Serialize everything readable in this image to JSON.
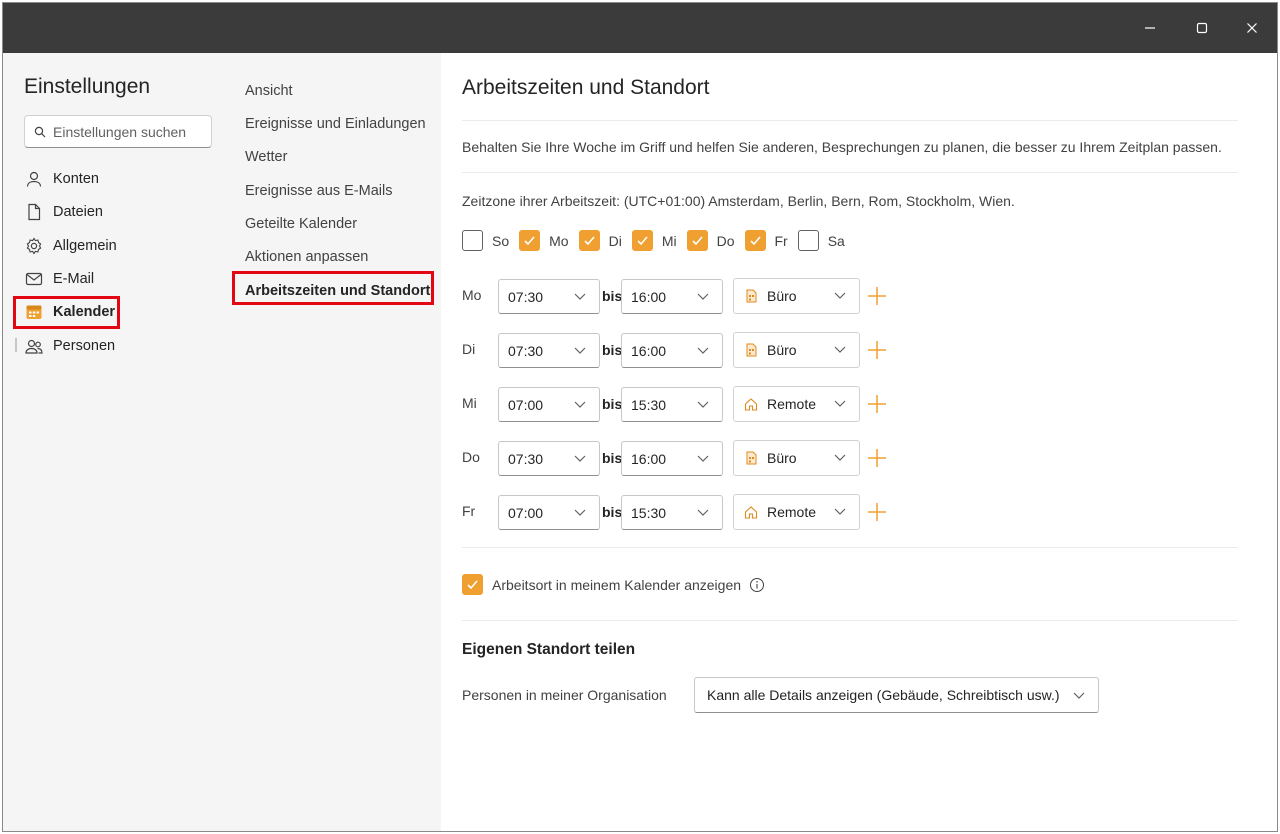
{
  "window": {
    "controls": {
      "minimize_icon": "minimize-icon",
      "maximize_icon": "maximize-icon",
      "close_icon": "close-icon"
    }
  },
  "settings_nav": {
    "heading": "Einstellungen",
    "search_placeholder": "Einstellungen suchen",
    "items": [
      {
        "label": "Konten",
        "icon": "person-icon"
      },
      {
        "label": "Dateien",
        "icon": "document-icon"
      },
      {
        "label": "Allgemein",
        "icon": "gear-icon"
      },
      {
        "label": "E-Mail",
        "icon": "mail-icon"
      },
      {
        "label": "Kalender",
        "icon": "calendar-icon",
        "active": true
      },
      {
        "label": "Personen",
        "icon": "people-icon"
      }
    ]
  },
  "calendar_nav": {
    "items": [
      {
        "label": "Ansicht"
      },
      {
        "label": "Ereignisse und Einladungen"
      },
      {
        "label": "Wetter"
      },
      {
        "label": "Ereignisse aus E-Mails"
      },
      {
        "label": "Geteilte Kalender"
      },
      {
        "label": "Aktionen anpassen"
      },
      {
        "label": "Arbeitszeiten und Standort",
        "active": true
      }
    ]
  },
  "main": {
    "title": "Arbeitszeiten und Standort",
    "description": "Behalten Sie Ihre Woche im Griff und helfen Sie anderen, Besprechungen zu planen, die besser zu Ihrem Zeitplan passen.",
    "timezone": "Zeitzone ihrer Arbeitszeit: (UTC+01:00) Amsterdam, Berlin, Bern, Rom, Stockholm, Wien.",
    "days": [
      {
        "label": "So",
        "checked": false
      },
      {
        "label": "Mo",
        "checked": true
      },
      {
        "label": "Di",
        "checked": true
      },
      {
        "label": "Mi",
        "checked": true
      },
      {
        "label": "Do",
        "checked": true
      },
      {
        "label": "Fr",
        "checked": true
      },
      {
        "label": "Sa",
        "checked": false
      }
    ],
    "bis_label": "bis",
    "schedule": [
      {
        "day": "Mo",
        "start": "07:30",
        "end": "16:00",
        "location": "Büro",
        "location_icon": "building-icon"
      },
      {
        "day": "Di",
        "start": "07:30",
        "end": "16:00",
        "location": "Büro",
        "location_icon": "building-icon"
      },
      {
        "day": "Mi",
        "start": "07:00",
        "end": "15:30",
        "location": "Remote",
        "location_icon": "home-icon"
      },
      {
        "day": "Do",
        "start": "07:30",
        "end": "16:00",
        "location": "Büro",
        "location_icon": "building-icon"
      },
      {
        "day": "Fr",
        "start": "07:00",
        "end": "15:30",
        "location": "Remote",
        "location_icon": "home-icon"
      }
    ],
    "show_location": {
      "label": "Arbeitsort in meinem Kalender anzeigen",
      "checked": true
    },
    "share_heading": "Eigenen Standort teilen",
    "org_label": "Personen in meiner Organisation",
    "org_value": "Kann alle Details anzeigen (Gebäude, Schreibtisch usw.)"
  },
  "colors": {
    "accent": "#f0a030",
    "highlight": "#e30613",
    "titlebar": "#3b3b3b"
  }
}
